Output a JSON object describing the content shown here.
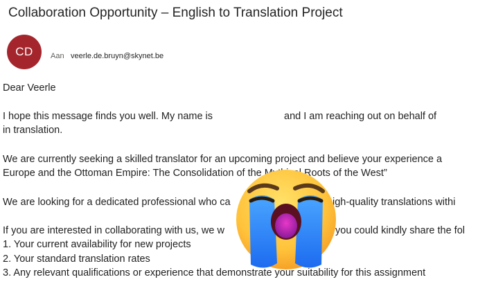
{
  "email": {
    "subject": "Collaboration Opportunity – English to Translation Project",
    "sender_initials": "CD",
    "avatar_color": "#a4262c",
    "to_label": "Aan",
    "to_address": "veerle.de.bruyn@skynet.be"
  },
  "body": {
    "greeting": "Dear Veerle",
    "p1_a": "I hope this message finds you well. My name is",
    "p1_b": "and I am reaching out on behalf of",
    "p1_c": "in translation.",
    "p2_a": "We are currently seeking a skilled translator for an upcoming project and believe your experience a",
    "p2_b": "Europe and the Ottoman Empire: The Consolidation of the Mythical Roots of the West”",
    "p3_a": "We are looking for a dedicated professional who ca",
    "p3_b": "igh-quality translations withi",
    "p4_a": "If you are interested in collaborating with us, we w",
    "p4_b": "you could kindly share the fol",
    "list": [
      " 1. Your current availability for new projects",
      " 2. Your standard translation rates",
      " 3. Any relevant qualifications or experience that demonstrate your suitability for this assignment"
    ]
  },
  "overlay": {
    "emoji": "loudly-crying-face"
  }
}
